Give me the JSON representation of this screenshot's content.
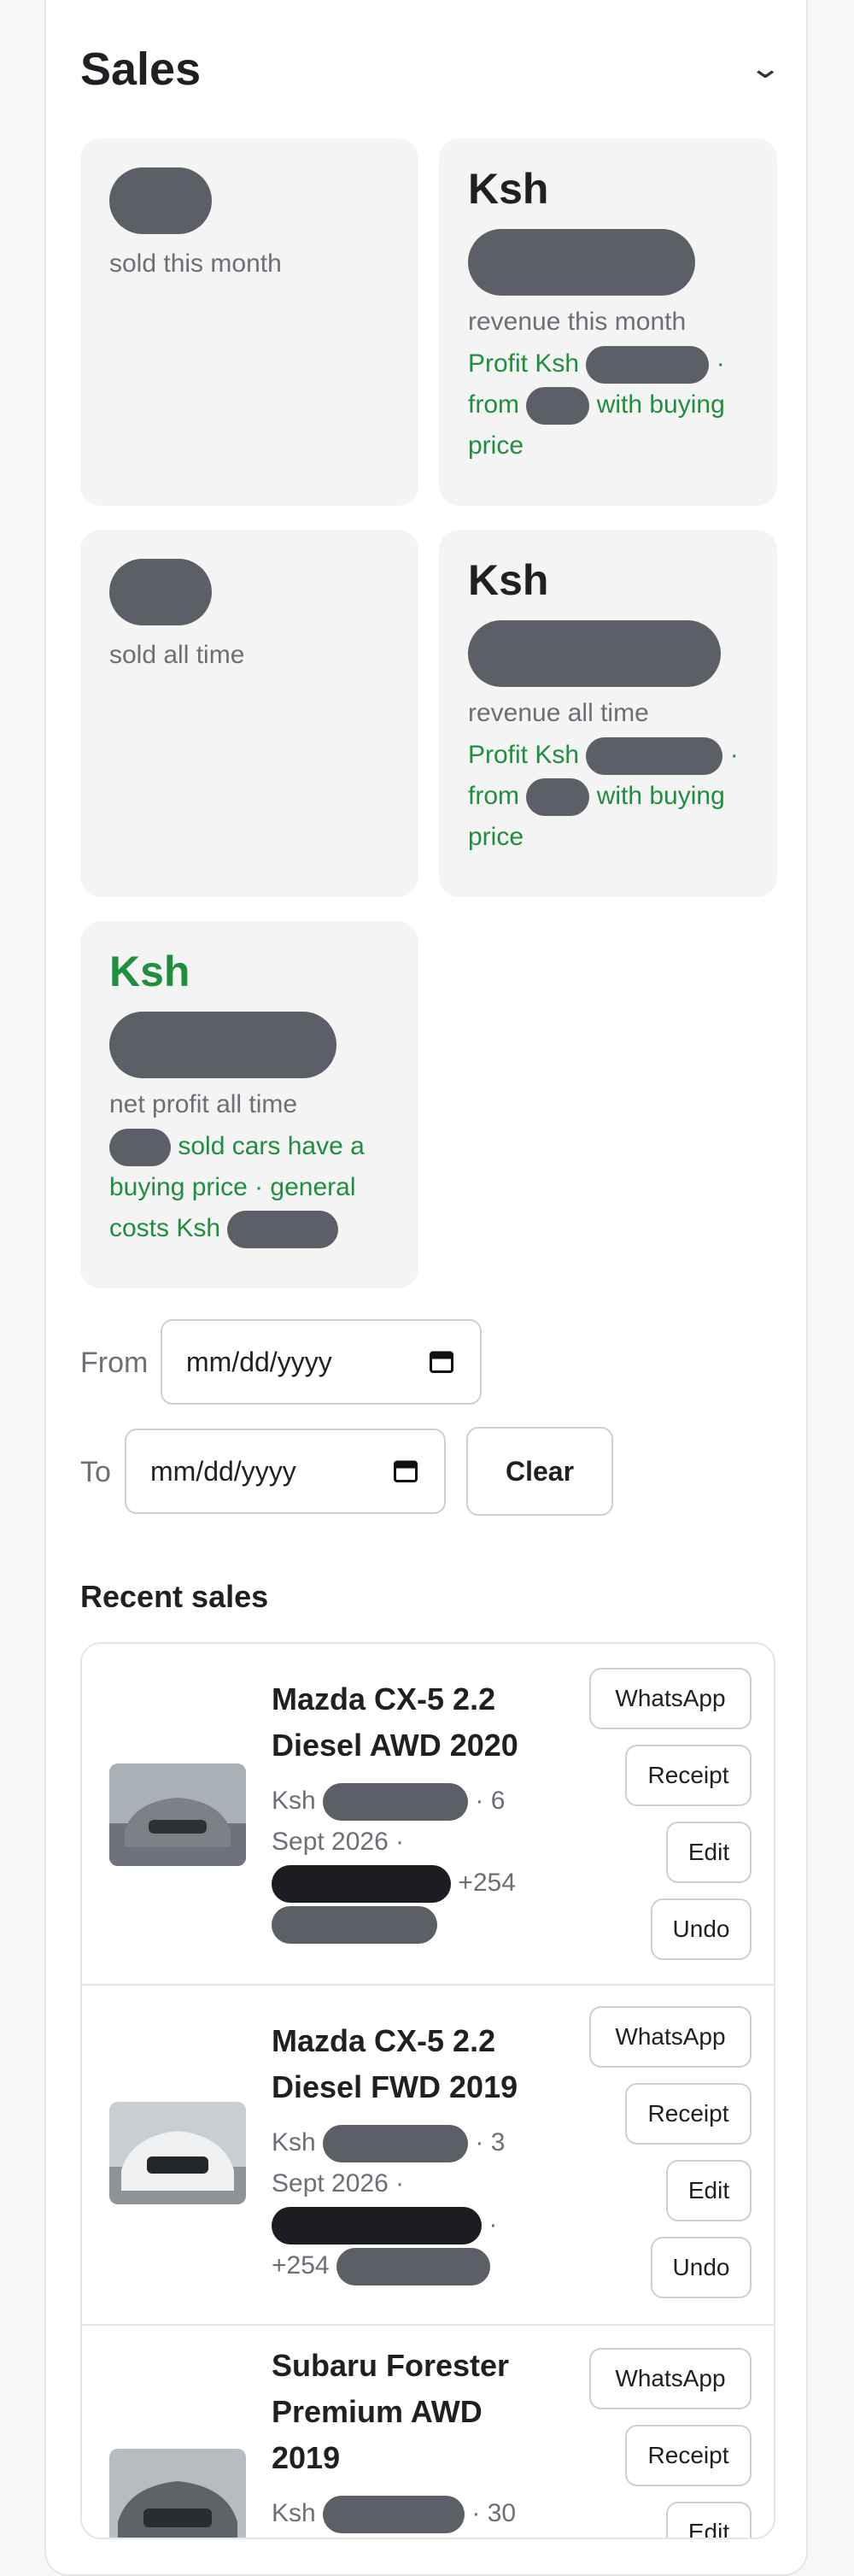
{
  "header": {
    "title": "Sales",
    "chevron_icon": "chevron-down-icon"
  },
  "stats": {
    "month_sold_label": "sold this month",
    "month_revenue_currency": "Ksh",
    "month_revenue_label": "revenue this month",
    "month_profit_prefix": "Profit Ksh",
    "month_from": "from",
    "month_with_buying": "with buying price",
    "all_sold_label": "sold all time",
    "all_revenue_currency": "Ksh",
    "all_revenue_label": "revenue all time",
    "all_profit_prefix": "Profit Ksh",
    "all_from": "from",
    "all_with_buying": "with buying price",
    "net_currency": "Ksh",
    "net_label": "net profit all time",
    "net_note_1": "sold cars have a",
    "net_note_2": "buying price · general",
    "net_note_3": "costs Ksh"
  },
  "filters": {
    "from_label": "From",
    "from_placeholder": "mm/dd/yyyy",
    "to_label": "To",
    "to_placeholder": "mm/dd/yyyy",
    "clear_label": "Clear"
  },
  "recent": {
    "title": "Recent sales",
    "actions": {
      "whatsapp": "WhatsApp",
      "receipt": "Receipt",
      "edit": "Edit",
      "undo": "Undo"
    },
    "items": [
      {
        "name_1": "Mazda CX-5 2.2",
        "name_2": "Diesel AWD 2020",
        "ksh": "Ksh",
        "date_a": "· 6",
        "date_b": "Sept 2026 ·",
        "phone_tail": "+254"
      },
      {
        "name_1": "Mazda CX-5 2.2",
        "name_2": "Diesel FWD 2019",
        "ksh": "Ksh",
        "date_a": "· 3",
        "date_b": "Sept 2026 ·",
        "phone_tail": "+254"
      },
      {
        "name_1": "Subaru Forester",
        "name_2": "Premium AWD",
        "name_3": "2019",
        "ksh": "Ksh",
        "date_a": "· 30"
      }
    ]
  },
  "colors": {
    "accent_green": "#1f8f3e",
    "redaction": "#5c5f66",
    "redaction_dark": "#1c1d20"
  }
}
